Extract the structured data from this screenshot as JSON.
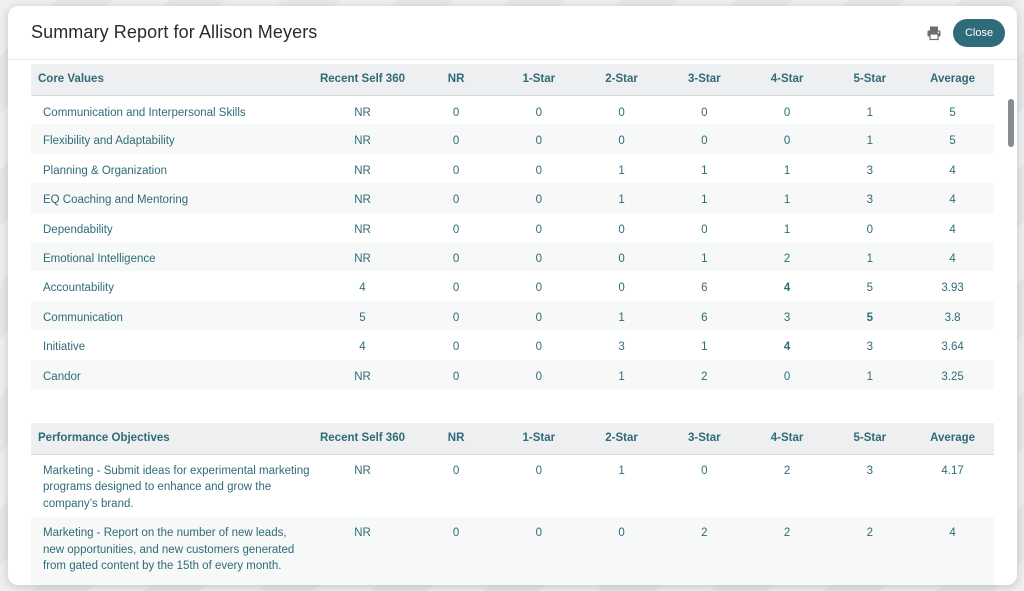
{
  "modal": {
    "title": "Summary Report for Allison Meyers",
    "close_label": "Close",
    "print_icon": "printer-icon"
  },
  "core_values": {
    "headers": [
      "Core Values",
      "Recent Self 360",
      "NR",
      "1-Star",
      "2-Star",
      "3-Star",
      "4-Star",
      "5-Star",
      "Average"
    ],
    "rows": [
      [
        "Communication and Interpersonal Skills",
        "NR",
        "0",
        "0",
        "0",
        "0",
        "0",
        "1",
        "5"
      ],
      [
        "Flexibility and Adaptability",
        "NR",
        "0",
        "0",
        "0",
        "0",
        "0",
        "1",
        "5"
      ],
      [
        "Planning & Organization",
        "NR",
        "0",
        "0",
        "1",
        "1",
        "1",
        "3",
        "4"
      ],
      [
        "EQ Coaching and Mentoring",
        "NR",
        "0",
        "0",
        "1",
        "1",
        "1",
        "3",
        "4"
      ],
      [
        "Dependability",
        "NR",
        "0",
        "0",
        "0",
        "0",
        "1",
        "0",
        "4"
      ],
      [
        "Emotional Intelligence",
        "NR",
        "0",
        "0",
        "0",
        "1",
        "2",
        "1",
        "4"
      ],
      [
        "Accountability",
        "4",
        "0",
        "0",
        "0",
        "6",
        "4",
        "5",
        "3.93"
      ],
      [
        "Communication",
        "5",
        "0",
        "0",
        "1",
        "6",
        "3",
        "5",
        "3.8"
      ],
      [
        "Initiative",
        "4",
        "0",
        "0",
        "3",
        "1",
        "4",
        "3",
        "3.64"
      ],
      [
        "Candor",
        "NR",
        "0",
        "0",
        "1",
        "2",
        "0",
        "1",
        "3.25"
      ]
    ]
  },
  "performance_objectives": {
    "headers": [
      "Performance Objectives",
      "Recent Self 360",
      "NR",
      "1-Star",
      "2-Star",
      "3-Star",
      "4-Star",
      "5-Star",
      "Average"
    ],
    "rows": [
      [
        "Marketing - Submit ideas for experimental marketing programs designed to enhance and grow the company’s brand.",
        "NR",
        "0",
        "0",
        "1",
        "0",
        "2",
        "3",
        "4.17"
      ],
      [
        "Marketing - Report on the number of new leads, new opportunities, and new customers generated from gated content by the 15th of every month.",
        "NR",
        "0",
        "0",
        "0",
        "2",
        "2",
        "2",
        "4"
      ]
    ]
  },
  "colors": {
    "accent": "#2f6b78",
    "header_bg": "#eeeff0",
    "alt_row_bg": "#f7f8f8"
  }
}
